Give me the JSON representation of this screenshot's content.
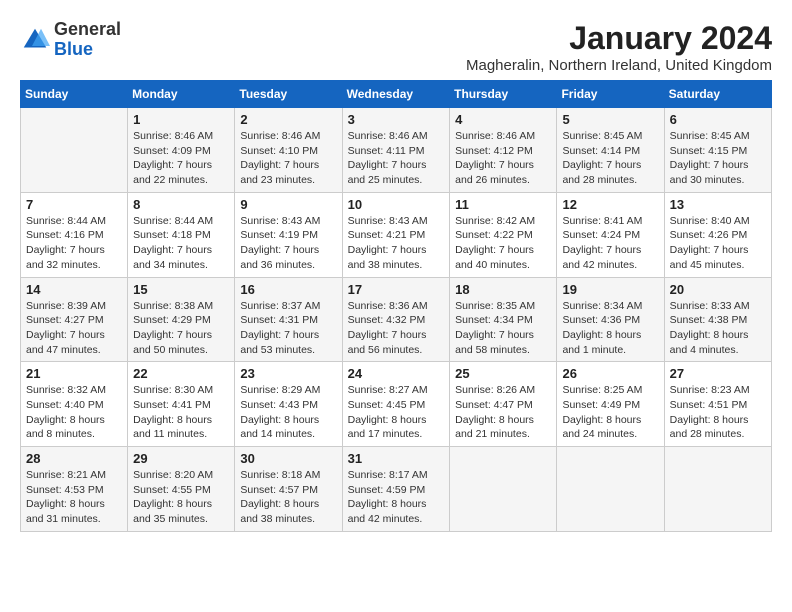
{
  "logo": {
    "general": "General",
    "blue": "Blue"
  },
  "title": "January 2024",
  "subtitle": "Magheralin, Northern Ireland, United Kingdom",
  "days_of_week": [
    "Sunday",
    "Monday",
    "Tuesday",
    "Wednesday",
    "Thursday",
    "Friday",
    "Saturday"
  ],
  "weeks": [
    [
      {
        "day": "",
        "info": ""
      },
      {
        "day": "1",
        "info": "Sunrise: 8:46 AM\nSunset: 4:09 PM\nDaylight: 7 hours\nand 22 minutes."
      },
      {
        "day": "2",
        "info": "Sunrise: 8:46 AM\nSunset: 4:10 PM\nDaylight: 7 hours\nand 23 minutes."
      },
      {
        "day": "3",
        "info": "Sunrise: 8:46 AM\nSunset: 4:11 PM\nDaylight: 7 hours\nand 25 minutes."
      },
      {
        "day": "4",
        "info": "Sunrise: 8:46 AM\nSunset: 4:12 PM\nDaylight: 7 hours\nand 26 minutes."
      },
      {
        "day": "5",
        "info": "Sunrise: 8:45 AM\nSunset: 4:14 PM\nDaylight: 7 hours\nand 28 minutes."
      },
      {
        "day": "6",
        "info": "Sunrise: 8:45 AM\nSunset: 4:15 PM\nDaylight: 7 hours\nand 30 minutes."
      }
    ],
    [
      {
        "day": "7",
        "info": "Sunrise: 8:44 AM\nSunset: 4:16 PM\nDaylight: 7 hours\nand 32 minutes."
      },
      {
        "day": "8",
        "info": "Sunrise: 8:44 AM\nSunset: 4:18 PM\nDaylight: 7 hours\nand 34 minutes."
      },
      {
        "day": "9",
        "info": "Sunrise: 8:43 AM\nSunset: 4:19 PM\nDaylight: 7 hours\nand 36 minutes."
      },
      {
        "day": "10",
        "info": "Sunrise: 8:43 AM\nSunset: 4:21 PM\nDaylight: 7 hours\nand 38 minutes."
      },
      {
        "day": "11",
        "info": "Sunrise: 8:42 AM\nSunset: 4:22 PM\nDaylight: 7 hours\nand 40 minutes."
      },
      {
        "day": "12",
        "info": "Sunrise: 8:41 AM\nSunset: 4:24 PM\nDaylight: 7 hours\nand 42 minutes."
      },
      {
        "day": "13",
        "info": "Sunrise: 8:40 AM\nSunset: 4:26 PM\nDaylight: 7 hours\nand 45 minutes."
      }
    ],
    [
      {
        "day": "14",
        "info": "Sunrise: 8:39 AM\nSunset: 4:27 PM\nDaylight: 7 hours\nand 47 minutes."
      },
      {
        "day": "15",
        "info": "Sunrise: 8:38 AM\nSunset: 4:29 PM\nDaylight: 7 hours\nand 50 minutes."
      },
      {
        "day": "16",
        "info": "Sunrise: 8:37 AM\nSunset: 4:31 PM\nDaylight: 7 hours\nand 53 minutes."
      },
      {
        "day": "17",
        "info": "Sunrise: 8:36 AM\nSunset: 4:32 PM\nDaylight: 7 hours\nand 56 minutes."
      },
      {
        "day": "18",
        "info": "Sunrise: 8:35 AM\nSunset: 4:34 PM\nDaylight: 7 hours\nand 58 minutes."
      },
      {
        "day": "19",
        "info": "Sunrise: 8:34 AM\nSunset: 4:36 PM\nDaylight: 8 hours\nand 1 minute."
      },
      {
        "day": "20",
        "info": "Sunrise: 8:33 AM\nSunset: 4:38 PM\nDaylight: 8 hours\nand 4 minutes."
      }
    ],
    [
      {
        "day": "21",
        "info": "Sunrise: 8:32 AM\nSunset: 4:40 PM\nDaylight: 8 hours\nand 8 minutes."
      },
      {
        "day": "22",
        "info": "Sunrise: 8:30 AM\nSunset: 4:41 PM\nDaylight: 8 hours\nand 11 minutes."
      },
      {
        "day": "23",
        "info": "Sunrise: 8:29 AM\nSunset: 4:43 PM\nDaylight: 8 hours\nand 14 minutes."
      },
      {
        "day": "24",
        "info": "Sunrise: 8:27 AM\nSunset: 4:45 PM\nDaylight: 8 hours\nand 17 minutes."
      },
      {
        "day": "25",
        "info": "Sunrise: 8:26 AM\nSunset: 4:47 PM\nDaylight: 8 hours\nand 21 minutes."
      },
      {
        "day": "26",
        "info": "Sunrise: 8:25 AM\nSunset: 4:49 PM\nDaylight: 8 hours\nand 24 minutes."
      },
      {
        "day": "27",
        "info": "Sunrise: 8:23 AM\nSunset: 4:51 PM\nDaylight: 8 hours\nand 28 minutes."
      }
    ],
    [
      {
        "day": "28",
        "info": "Sunrise: 8:21 AM\nSunset: 4:53 PM\nDaylight: 8 hours\nand 31 minutes."
      },
      {
        "day": "29",
        "info": "Sunrise: 8:20 AM\nSunset: 4:55 PM\nDaylight: 8 hours\nand 35 minutes."
      },
      {
        "day": "30",
        "info": "Sunrise: 8:18 AM\nSunset: 4:57 PM\nDaylight: 8 hours\nand 38 minutes."
      },
      {
        "day": "31",
        "info": "Sunrise: 8:17 AM\nSunset: 4:59 PM\nDaylight: 8 hours\nand 42 minutes."
      },
      {
        "day": "",
        "info": ""
      },
      {
        "day": "",
        "info": ""
      },
      {
        "day": "",
        "info": ""
      }
    ]
  ]
}
